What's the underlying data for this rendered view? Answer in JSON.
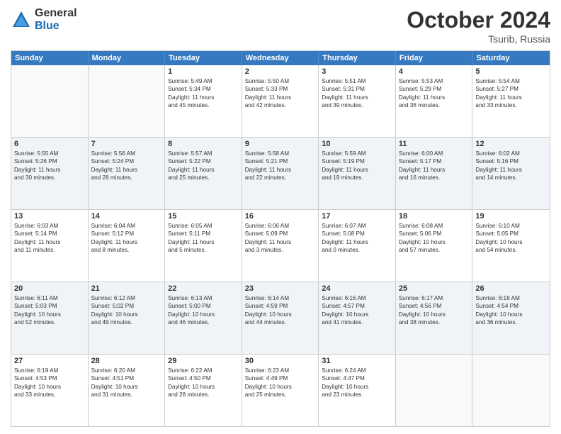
{
  "logo": {
    "general": "General",
    "blue": "Blue"
  },
  "title": "October 2024",
  "location": "Tsurib, Russia",
  "header_days": [
    "Sunday",
    "Monday",
    "Tuesday",
    "Wednesday",
    "Thursday",
    "Friday",
    "Saturday"
  ],
  "rows": [
    {
      "alt": false,
      "cells": [
        {
          "day": "",
          "lines": []
        },
        {
          "day": "",
          "lines": []
        },
        {
          "day": "1",
          "lines": [
            "Sunrise: 5:49 AM",
            "Sunset: 5:34 PM",
            "Daylight: 11 hours",
            "and 45 minutes."
          ]
        },
        {
          "day": "2",
          "lines": [
            "Sunrise: 5:50 AM",
            "Sunset: 5:33 PM",
            "Daylight: 11 hours",
            "and 42 minutes."
          ]
        },
        {
          "day": "3",
          "lines": [
            "Sunrise: 5:51 AM",
            "Sunset: 5:31 PM",
            "Daylight: 11 hours",
            "and 39 minutes."
          ]
        },
        {
          "day": "4",
          "lines": [
            "Sunrise: 5:53 AM",
            "Sunset: 5:29 PM",
            "Daylight: 11 hours",
            "and 36 minutes."
          ]
        },
        {
          "day": "5",
          "lines": [
            "Sunrise: 5:54 AM",
            "Sunset: 5:27 PM",
            "Daylight: 11 hours",
            "and 33 minutes."
          ]
        }
      ]
    },
    {
      "alt": true,
      "cells": [
        {
          "day": "6",
          "lines": [
            "Sunrise: 5:55 AM",
            "Sunset: 5:26 PM",
            "Daylight: 11 hours",
            "and 30 minutes."
          ]
        },
        {
          "day": "7",
          "lines": [
            "Sunrise: 5:56 AM",
            "Sunset: 5:24 PM",
            "Daylight: 11 hours",
            "and 28 minutes."
          ]
        },
        {
          "day": "8",
          "lines": [
            "Sunrise: 5:57 AM",
            "Sunset: 5:22 PM",
            "Daylight: 11 hours",
            "and 25 minutes."
          ]
        },
        {
          "day": "9",
          "lines": [
            "Sunrise: 5:58 AM",
            "Sunset: 5:21 PM",
            "Daylight: 11 hours",
            "and 22 minutes."
          ]
        },
        {
          "day": "10",
          "lines": [
            "Sunrise: 5:59 AM",
            "Sunset: 5:19 PM",
            "Daylight: 11 hours",
            "and 19 minutes."
          ]
        },
        {
          "day": "11",
          "lines": [
            "Sunrise: 6:00 AM",
            "Sunset: 5:17 PM",
            "Daylight: 11 hours",
            "and 16 minutes."
          ]
        },
        {
          "day": "12",
          "lines": [
            "Sunrise: 6:02 AM",
            "Sunset: 5:16 PM",
            "Daylight: 11 hours",
            "and 14 minutes."
          ]
        }
      ]
    },
    {
      "alt": false,
      "cells": [
        {
          "day": "13",
          "lines": [
            "Sunrise: 6:03 AM",
            "Sunset: 5:14 PM",
            "Daylight: 11 hours",
            "and 11 minutes."
          ]
        },
        {
          "day": "14",
          "lines": [
            "Sunrise: 6:04 AM",
            "Sunset: 5:12 PM",
            "Daylight: 11 hours",
            "and 8 minutes."
          ]
        },
        {
          "day": "15",
          "lines": [
            "Sunrise: 6:05 AM",
            "Sunset: 5:11 PM",
            "Daylight: 11 hours",
            "and 5 minutes."
          ]
        },
        {
          "day": "16",
          "lines": [
            "Sunrise: 6:06 AM",
            "Sunset: 5:09 PM",
            "Daylight: 11 hours",
            "and 3 minutes."
          ]
        },
        {
          "day": "17",
          "lines": [
            "Sunrise: 6:07 AM",
            "Sunset: 5:08 PM",
            "Daylight: 11 hours",
            "and 0 minutes."
          ]
        },
        {
          "day": "18",
          "lines": [
            "Sunrise: 6:08 AM",
            "Sunset: 5:06 PM",
            "Daylight: 10 hours",
            "and 57 minutes."
          ]
        },
        {
          "day": "19",
          "lines": [
            "Sunrise: 6:10 AM",
            "Sunset: 5:05 PM",
            "Daylight: 10 hours",
            "and 54 minutes."
          ]
        }
      ]
    },
    {
      "alt": true,
      "cells": [
        {
          "day": "20",
          "lines": [
            "Sunrise: 6:11 AM",
            "Sunset: 5:03 PM",
            "Daylight: 10 hours",
            "and 52 minutes."
          ]
        },
        {
          "day": "21",
          "lines": [
            "Sunrise: 6:12 AM",
            "Sunset: 5:02 PM",
            "Daylight: 10 hours",
            "and 49 minutes."
          ]
        },
        {
          "day": "22",
          "lines": [
            "Sunrise: 6:13 AM",
            "Sunset: 5:00 PM",
            "Daylight: 10 hours",
            "and 46 minutes."
          ]
        },
        {
          "day": "23",
          "lines": [
            "Sunrise: 6:14 AM",
            "Sunset: 4:59 PM",
            "Daylight: 10 hours",
            "and 44 minutes."
          ]
        },
        {
          "day": "24",
          "lines": [
            "Sunrise: 6:16 AM",
            "Sunset: 4:57 PM",
            "Daylight: 10 hours",
            "and 41 minutes."
          ]
        },
        {
          "day": "25",
          "lines": [
            "Sunrise: 6:17 AM",
            "Sunset: 4:56 PM",
            "Daylight: 10 hours",
            "and 38 minutes."
          ]
        },
        {
          "day": "26",
          "lines": [
            "Sunrise: 6:18 AM",
            "Sunset: 4:54 PM",
            "Daylight: 10 hours",
            "and 36 minutes."
          ]
        }
      ]
    },
    {
      "alt": false,
      "cells": [
        {
          "day": "27",
          "lines": [
            "Sunrise: 6:19 AM",
            "Sunset: 4:53 PM",
            "Daylight: 10 hours",
            "and 33 minutes."
          ]
        },
        {
          "day": "28",
          "lines": [
            "Sunrise: 6:20 AM",
            "Sunset: 4:51 PM",
            "Daylight: 10 hours",
            "and 31 minutes."
          ]
        },
        {
          "day": "29",
          "lines": [
            "Sunrise: 6:22 AM",
            "Sunset: 4:50 PM",
            "Daylight: 10 hours",
            "and 28 minutes."
          ]
        },
        {
          "day": "30",
          "lines": [
            "Sunrise: 6:23 AM",
            "Sunset: 4:49 PM",
            "Daylight: 10 hours",
            "and 25 minutes."
          ]
        },
        {
          "day": "31",
          "lines": [
            "Sunrise: 6:24 AM",
            "Sunset: 4:47 PM",
            "Daylight: 10 hours",
            "and 23 minutes."
          ]
        },
        {
          "day": "",
          "lines": []
        },
        {
          "day": "",
          "lines": []
        }
      ]
    }
  ]
}
